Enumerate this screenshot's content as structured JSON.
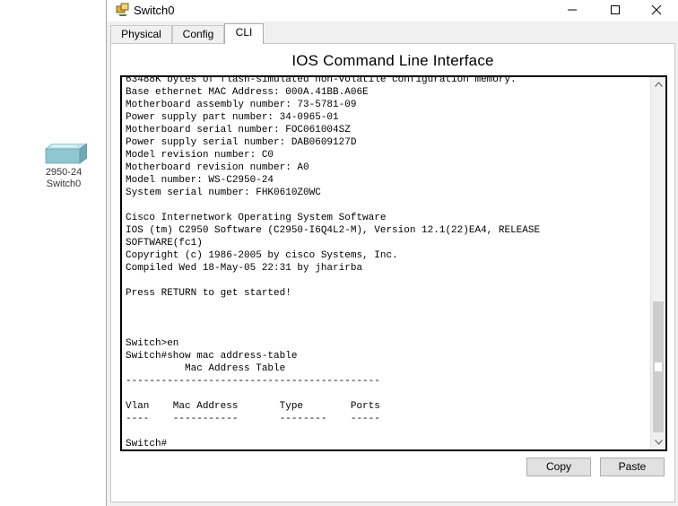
{
  "desktop": {
    "device": {
      "model_label": "2950-24",
      "name_label": "Switch0",
      "icon": "switch-icon"
    }
  },
  "window": {
    "title": "Switch0",
    "app_icon": "packet-tracer-icon",
    "controls": [
      "minimize-icon",
      "maximize-icon",
      "close-icon"
    ]
  },
  "tabs": [
    {
      "label": "Physical",
      "active": false
    },
    {
      "label": "Config",
      "active": false
    },
    {
      "label": "CLI",
      "active": true
    }
  ],
  "cli": {
    "heading": "IOS Command Line Interface",
    "terminal_text": "63488K bytes of flash-simulated non-volatile configuration memory.\nBase ethernet MAC Address: 000A.41BB.A06E\nMotherboard assembly number: 73-5781-09\nPower supply part number: 34-0965-01\nMotherboard serial number: FOC061004SZ\nPower supply serial number: DAB0609127D\nModel revision number: C0\nMotherboard revision number: A0\nModel number: WS-C2950-24\nSystem serial number: FHK0610Z0WC\n\nCisco Internetwork Operating System Software\nIOS (tm) C2950 Software (C2950-I6Q4L2-M), Version 12.1(22)EA4, RELEASE\nSOFTWARE(fc1)\nCopyright (c) 1986-2005 by cisco Systems, Inc.\nCompiled Wed 18-May-05 22:31 by jharirba\n\nPress RETURN to get started!\n\n\n\nSwitch>en\nSwitch#show mac address-table\n          Mac Address Table\n-------------------------------------------\n\nVlan    Mac Address       Type        Ports\n----    -----------       --------    -----\n\nSwitch#",
    "copy_label": "Copy",
    "paste_label": "Paste"
  },
  "colors": {
    "window_bg": "#f0f0f0",
    "panel_bg": "#ffffff",
    "terminal_border": "#000000",
    "button_bg": "#e1e1e1"
  }
}
